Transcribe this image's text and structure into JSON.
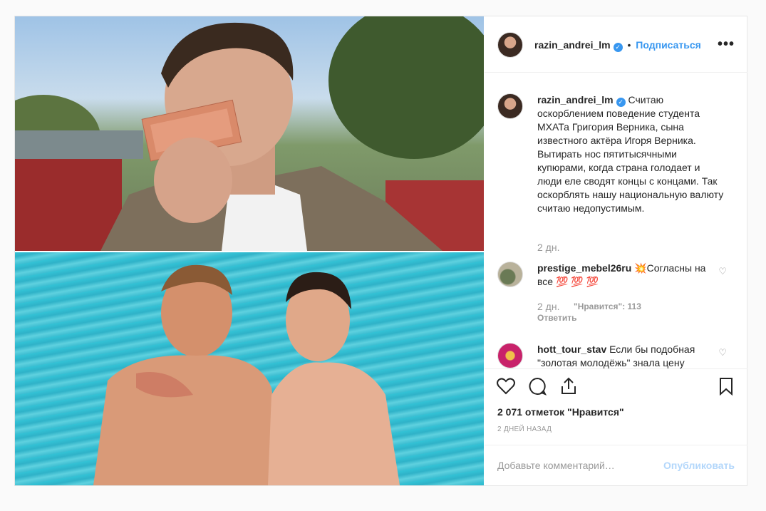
{
  "header": {
    "username": "razin_andrei_lm",
    "separator": "•",
    "follow_label": "Подписаться",
    "more_label": "•••"
  },
  "caption": {
    "username": "razin_andrei_lm",
    "text": "Считаю оскорблением поведение студента МХАТа Григория Верника, сына известного актёра Игоря Верника. Вытирать нос пятитысячными купюрами, когда страна голодает и люди еле сводят концы с концами. Так оскорблять нашу национальную валюту считаю недопустимым.",
    "time": "2 дн."
  },
  "comments": [
    {
      "username": "prestige_mebel26ru",
      "text": "💥Согласны на все 💯 💯 💯",
      "time": "2 дн.",
      "likes": "\"Нравится\": 113",
      "reply": "Ответить"
    },
    {
      "username": "hott_tour_stav",
      "text": "Если бы подобная \"золотая молодёжь\" знала цену заработанных своим трудом"
    }
  ],
  "footer": {
    "likes": "2 071 отметок \"Нравится\"",
    "date": "2 ДНЕЙ НАЗАД",
    "comment_placeholder": "Добавьте комментарий…",
    "publish_label": "Опубликовать"
  },
  "icons": {
    "verified": "verified-badge-icon",
    "like": "heart-icon",
    "comment": "comment-bubble-icon",
    "share": "share-icon",
    "save": "bookmark-icon"
  },
  "colors": {
    "accent": "#3897f0",
    "muted": "#999999",
    "publish_disabled": "#b3d7fb"
  }
}
